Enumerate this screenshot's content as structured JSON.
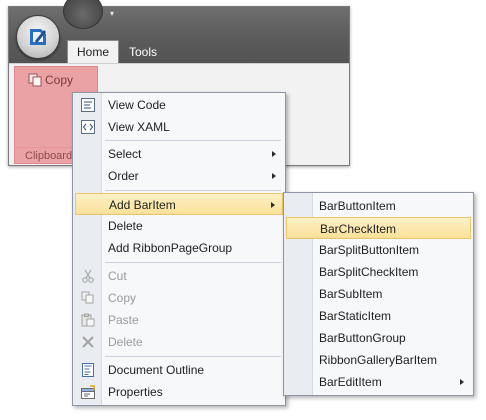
{
  "ribbon": {
    "tabs": [
      {
        "label": "Home"
      },
      {
        "label": "Tools"
      }
    ],
    "qat_glyph": "▾",
    "clipboard_group": {
      "copy_label": "Copy",
      "group_label": "Clipboard"
    }
  },
  "context_menu": {
    "items": [
      {
        "label": "View Code",
        "icon": "view-code-icon"
      },
      {
        "label": "View XAML",
        "icon": "view-xaml-icon"
      },
      {
        "label": "Select",
        "submenu": true
      },
      {
        "label": "Order",
        "submenu": true
      },
      {
        "label": "Add BarItem",
        "submenu": true,
        "highlighted": true
      },
      {
        "label": "Delete"
      },
      {
        "label": "Add RibbonPageGroup"
      },
      {
        "label": "Cut",
        "disabled": true,
        "icon": "scissors-icon"
      },
      {
        "label": "Copy",
        "disabled": true,
        "icon": "copy-icon"
      },
      {
        "label": "Paste",
        "disabled": true,
        "icon": "paste-icon"
      },
      {
        "label": "Delete",
        "disabled": true,
        "icon": "delete-x-icon"
      },
      {
        "label": "Document Outline",
        "icon": "document-outline-icon"
      },
      {
        "label": "Properties",
        "icon": "properties-icon"
      }
    ]
  },
  "submenu": {
    "items": [
      {
        "label": "BarButtonItem"
      },
      {
        "label": "BarCheckItem",
        "highlighted": true
      },
      {
        "label": "BarSplitButtonItem"
      },
      {
        "label": "BarSplitCheckItem"
      },
      {
        "label": "BarSubItem"
      },
      {
        "label": "BarStaticItem"
      },
      {
        "label": "BarButtonGroup"
      },
      {
        "label": "RibbonGalleryBarItem"
      },
      {
        "label": "BarEditItem",
        "submenu": true
      }
    ]
  },
  "colors": {
    "accent_highlight": "#fbe199",
    "clipboard_group_bg": "#eba2a4",
    "titlebar": "#5a5a5a"
  }
}
